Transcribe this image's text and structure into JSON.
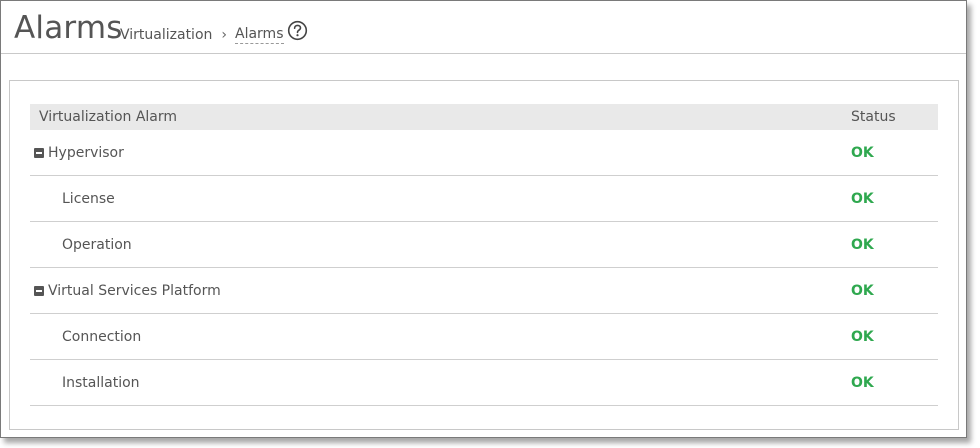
{
  "header": {
    "title": "Alarms",
    "breadcrumb": {
      "parent": "Virtualization",
      "separator": "›",
      "current": "Alarms"
    },
    "help_icon": "help-circle-icon"
  },
  "table": {
    "columns": {
      "name": "Virtualization Alarm",
      "status": "Status"
    },
    "rows": [
      {
        "name": "Hypervisor",
        "status": "OK",
        "level": "parent",
        "expanded": true
      },
      {
        "name": "License",
        "status": "OK",
        "level": "child"
      },
      {
        "name": "Operation",
        "status": "OK",
        "level": "child"
      },
      {
        "name": "Virtual Services Platform",
        "status": "OK",
        "level": "parent",
        "expanded": true
      },
      {
        "name": "Connection",
        "status": "OK",
        "level": "child"
      },
      {
        "name": "Installation",
        "status": "OK",
        "level": "child"
      }
    ]
  },
  "colors": {
    "status_ok": "#2fa84f",
    "header_bg": "#e9e9e9"
  }
}
